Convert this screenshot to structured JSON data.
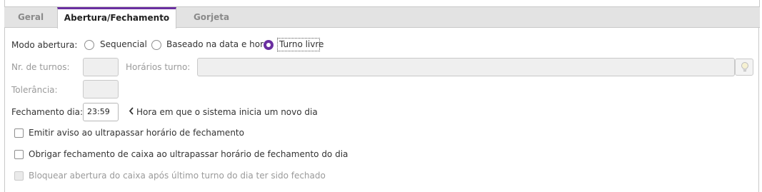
{
  "tabs": [
    {
      "label": "Geral",
      "active": false
    },
    {
      "label": "Abertura/Fechamento",
      "active": true
    },
    {
      "label": "Gorjeta",
      "active": false
    }
  ],
  "accent_color": "#6a2fa0",
  "modo_abertura": {
    "label": "Modo abertura:",
    "options": [
      {
        "label": "Sequencial",
        "selected": false
      },
      {
        "label": "Baseado na data e hora",
        "selected": false
      },
      {
        "label": "Turno livre",
        "selected": true
      }
    ]
  },
  "nr_turnos": {
    "label": "Nr. de turnos:",
    "value": ""
  },
  "horarios_turno": {
    "label": "Horários turno:",
    "value": "",
    "button_icon": "lightbulb-icon"
  },
  "tolerancia": {
    "label": "Tolerância:",
    "value": ""
  },
  "fechamento_dia": {
    "label": "Fechamento dia:",
    "value": "23:59",
    "hint_icon": "chevron-left-icon",
    "hint": "Hora em que o sistema inicia um novo dia"
  },
  "checkboxes": [
    {
      "label": "Emitir aviso ao ultrapassar horário de fechamento",
      "checked": false,
      "enabled": true
    },
    {
      "label": "Obrigar fechamento de caixa ao ultrapassar horário de fechamento do dia",
      "checked": false,
      "enabled": true
    },
    {
      "label": "Bloquear abertura do caixa após último turno do dia ter sido fechado",
      "checked": false,
      "enabled": false
    }
  ]
}
